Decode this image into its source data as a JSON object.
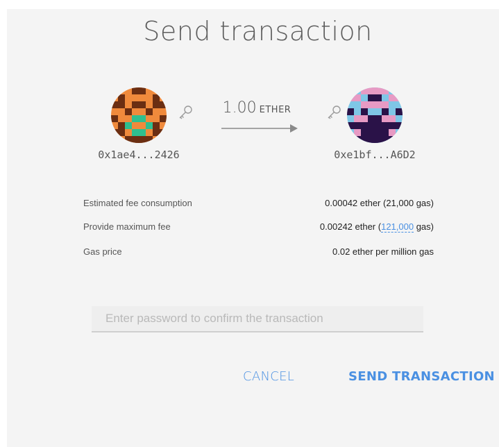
{
  "dialog": {
    "title": "Send transaction"
  },
  "transaction": {
    "from_address": "0x1ae4...2426",
    "to_address": "0xe1bf...A6D2",
    "amount": "1.00",
    "unit": "ETHER",
    "from_key_icon": "key-icon",
    "to_key_icon": "key-icon",
    "arrow_icon": "arrow-right-icon"
  },
  "fees": {
    "estimated": {
      "label": "Estimated fee consumption",
      "value": "0.00042 ether (21,000 gas)"
    },
    "maximum": {
      "label": "Provide maximum fee",
      "value_prefix": "0.00242 ether (",
      "gas_amount": "121,000",
      "value_suffix": " gas)"
    },
    "gas_price": {
      "label": "Gas price",
      "value": "0.02 ether per million gas"
    }
  },
  "password": {
    "placeholder": "Enter password to confirm the transaction",
    "value": ""
  },
  "actions": {
    "cancel_label": "CANCEL",
    "send_label": "SEND TRANSACTION"
  },
  "colors": {
    "accent": "#4a90e2",
    "background": "#f4f4f4",
    "text": "#333333"
  }
}
